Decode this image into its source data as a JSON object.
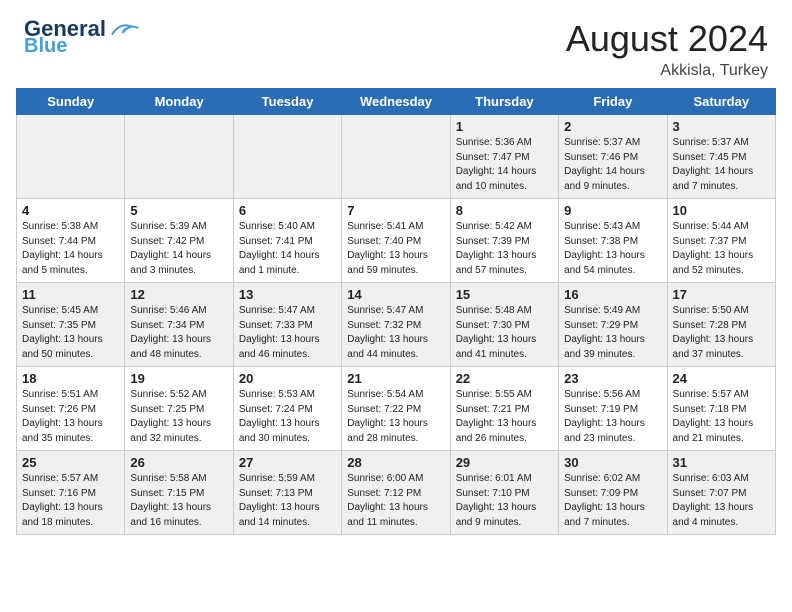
{
  "header": {
    "logo_general": "General",
    "logo_blue": "Blue",
    "month_year": "August 2024",
    "location": "Akkisla, Turkey"
  },
  "weekdays": [
    "Sunday",
    "Monday",
    "Tuesday",
    "Wednesday",
    "Thursday",
    "Friday",
    "Saturday"
  ],
  "weeks": [
    [
      {
        "day": "",
        "info": ""
      },
      {
        "day": "",
        "info": ""
      },
      {
        "day": "",
        "info": ""
      },
      {
        "day": "",
        "info": ""
      },
      {
        "day": "1",
        "info": "Sunrise: 5:36 AM\nSunset: 7:47 PM\nDaylight: 14 hours\nand 10 minutes."
      },
      {
        "day": "2",
        "info": "Sunrise: 5:37 AM\nSunset: 7:46 PM\nDaylight: 14 hours\nand 9 minutes."
      },
      {
        "day": "3",
        "info": "Sunrise: 5:37 AM\nSunset: 7:45 PM\nDaylight: 14 hours\nand 7 minutes."
      }
    ],
    [
      {
        "day": "4",
        "info": "Sunrise: 5:38 AM\nSunset: 7:44 PM\nDaylight: 14 hours\nand 5 minutes."
      },
      {
        "day": "5",
        "info": "Sunrise: 5:39 AM\nSunset: 7:42 PM\nDaylight: 14 hours\nand 3 minutes."
      },
      {
        "day": "6",
        "info": "Sunrise: 5:40 AM\nSunset: 7:41 PM\nDaylight: 14 hours\nand 1 minute."
      },
      {
        "day": "7",
        "info": "Sunrise: 5:41 AM\nSunset: 7:40 PM\nDaylight: 13 hours\nand 59 minutes."
      },
      {
        "day": "8",
        "info": "Sunrise: 5:42 AM\nSunset: 7:39 PM\nDaylight: 13 hours\nand 57 minutes."
      },
      {
        "day": "9",
        "info": "Sunrise: 5:43 AM\nSunset: 7:38 PM\nDaylight: 13 hours\nand 54 minutes."
      },
      {
        "day": "10",
        "info": "Sunrise: 5:44 AM\nSunset: 7:37 PM\nDaylight: 13 hours\nand 52 minutes."
      }
    ],
    [
      {
        "day": "11",
        "info": "Sunrise: 5:45 AM\nSunset: 7:35 PM\nDaylight: 13 hours\nand 50 minutes."
      },
      {
        "day": "12",
        "info": "Sunrise: 5:46 AM\nSunset: 7:34 PM\nDaylight: 13 hours\nand 48 minutes."
      },
      {
        "day": "13",
        "info": "Sunrise: 5:47 AM\nSunset: 7:33 PM\nDaylight: 13 hours\nand 46 minutes."
      },
      {
        "day": "14",
        "info": "Sunrise: 5:47 AM\nSunset: 7:32 PM\nDaylight: 13 hours\nand 44 minutes."
      },
      {
        "day": "15",
        "info": "Sunrise: 5:48 AM\nSunset: 7:30 PM\nDaylight: 13 hours\nand 41 minutes."
      },
      {
        "day": "16",
        "info": "Sunrise: 5:49 AM\nSunset: 7:29 PM\nDaylight: 13 hours\nand 39 minutes."
      },
      {
        "day": "17",
        "info": "Sunrise: 5:50 AM\nSunset: 7:28 PM\nDaylight: 13 hours\nand 37 minutes."
      }
    ],
    [
      {
        "day": "18",
        "info": "Sunrise: 5:51 AM\nSunset: 7:26 PM\nDaylight: 13 hours\nand 35 minutes."
      },
      {
        "day": "19",
        "info": "Sunrise: 5:52 AM\nSunset: 7:25 PM\nDaylight: 13 hours\nand 32 minutes."
      },
      {
        "day": "20",
        "info": "Sunrise: 5:53 AM\nSunset: 7:24 PM\nDaylight: 13 hours\nand 30 minutes."
      },
      {
        "day": "21",
        "info": "Sunrise: 5:54 AM\nSunset: 7:22 PM\nDaylight: 13 hours\nand 28 minutes."
      },
      {
        "day": "22",
        "info": "Sunrise: 5:55 AM\nSunset: 7:21 PM\nDaylight: 13 hours\nand 26 minutes."
      },
      {
        "day": "23",
        "info": "Sunrise: 5:56 AM\nSunset: 7:19 PM\nDaylight: 13 hours\nand 23 minutes."
      },
      {
        "day": "24",
        "info": "Sunrise: 5:57 AM\nSunset: 7:18 PM\nDaylight: 13 hours\nand 21 minutes."
      }
    ],
    [
      {
        "day": "25",
        "info": "Sunrise: 5:57 AM\nSunset: 7:16 PM\nDaylight: 13 hours\nand 18 minutes."
      },
      {
        "day": "26",
        "info": "Sunrise: 5:58 AM\nSunset: 7:15 PM\nDaylight: 13 hours\nand 16 minutes."
      },
      {
        "day": "27",
        "info": "Sunrise: 5:59 AM\nSunset: 7:13 PM\nDaylight: 13 hours\nand 14 minutes."
      },
      {
        "day": "28",
        "info": "Sunrise: 6:00 AM\nSunset: 7:12 PM\nDaylight: 13 hours\nand 11 minutes."
      },
      {
        "day": "29",
        "info": "Sunrise: 6:01 AM\nSunset: 7:10 PM\nDaylight: 13 hours\nand 9 minutes."
      },
      {
        "day": "30",
        "info": "Sunrise: 6:02 AM\nSunset: 7:09 PM\nDaylight: 13 hours\nand 7 minutes."
      },
      {
        "day": "31",
        "info": "Sunrise: 6:03 AM\nSunset: 7:07 PM\nDaylight: 13 hours\nand 4 minutes."
      }
    ]
  ]
}
